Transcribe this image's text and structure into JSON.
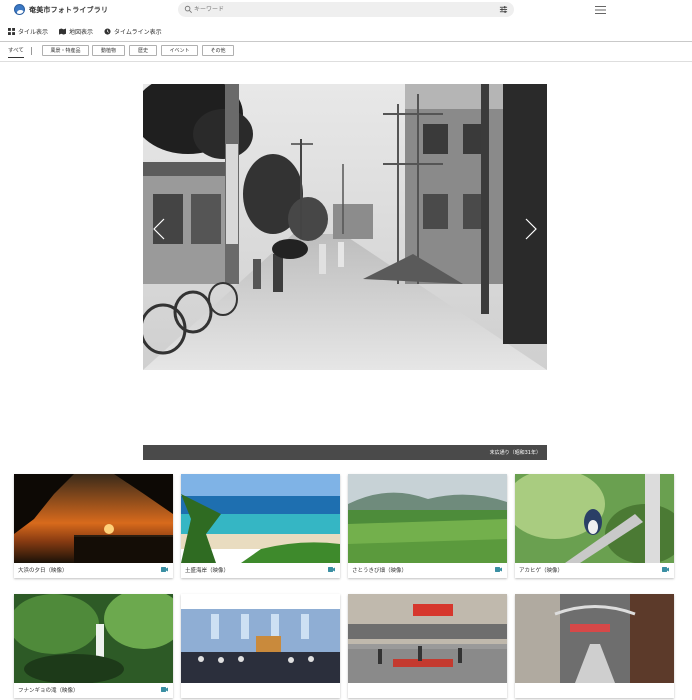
{
  "header": {
    "site_title": "奄美市フォトライブラリ",
    "search_placeholder": "キーワード"
  },
  "view_tabs": [
    {
      "label": "タイル表示",
      "icon": "grid-icon"
    },
    {
      "label": "地図表示",
      "icon": "map-icon"
    },
    {
      "label": "タイムライン表示",
      "icon": "clock-icon"
    }
  ],
  "categories": {
    "all_label": "すべて",
    "items": [
      "風景・特産品",
      "動植物",
      "歴史",
      "イベント",
      "その他"
    ]
  },
  "hero": {
    "caption": "末広通り（昭和31年）"
  },
  "cards": [
    {
      "label": "大浜の夕日（映像）",
      "icon": "video-icon"
    },
    {
      "label": "土盛海岸（映像）",
      "icon": "video-icon"
    },
    {
      "label": "さとうきび畑（映像）",
      "icon": "video-icon"
    },
    {
      "label": "アカヒゲ（映像）",
      "icon": "video-icon"
    },
    {
      "label": "フナンギョの滝（映像）",
      "icon": "video-icon"
    },
    {
      "label": "",
      "icon": ""
    },
    {
      "label": "",
      "icon": ""
    },
    {
      "label": "",
      "icon": ""
    }
  ],
  "colors": {
    "accent_teal": "#3a8fa3",
    "caption_bar": "#4a4a4a"
  }
}
